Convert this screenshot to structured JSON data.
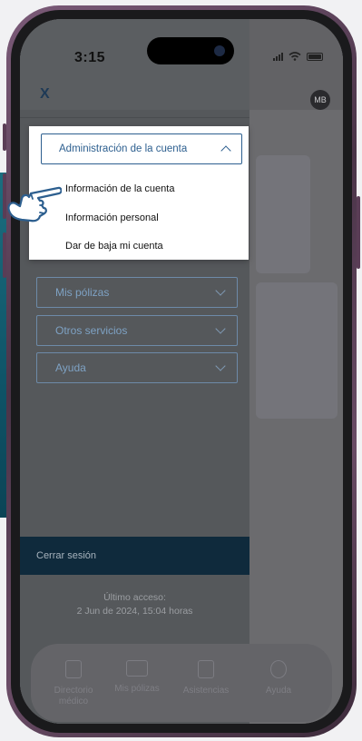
{
  "status_bar": {
    "time": "3:15"
  },
  "header": {
    "close_icon": "close-icon",
    "close_label": "X",
    "avatar_initials": "MB"
  },
  "account_menu": {
    "title": "Administración de la cuenta",
    "items": [
      {
        "label": "Información de la cuenta"
      },
      {
        "label": "Información personal"
      },
      {
        "label": "Dar de baja mi cuenta"
      }
    ]
  },
  "menu_sections": [
    {
      "label": "Mis pólizas"
    },
    {
      "label": "Otros servicios"
    },
    {
      "label": "Ayuda"
    }
  ],
  "logout": {
    "label": "Cerrar sesión"
  },
  "last_access": {
    "label": "Último acceso:",
    "value": "2 Jun de 2024, 15:04 horas"
  },
  "bottom_nav": [
    {
      "label": "Directorio médico",
      "icon": "phonebook-icon"
    },
    {
      "label": "Mis pólizas",
      "icon": "card-icon"
    },
    {
      "label": "Asistencias",
      "icon": "document-icon"
    },
    {
      "label": "Ayuda",
      "icon": "help-icon"
    }
  ],
  "colors": {
    "accent": "#2d5f8f",
    "logout_bar": "#0f2a3c",
    "phone_frame": "#6a4c66"
  }
}
